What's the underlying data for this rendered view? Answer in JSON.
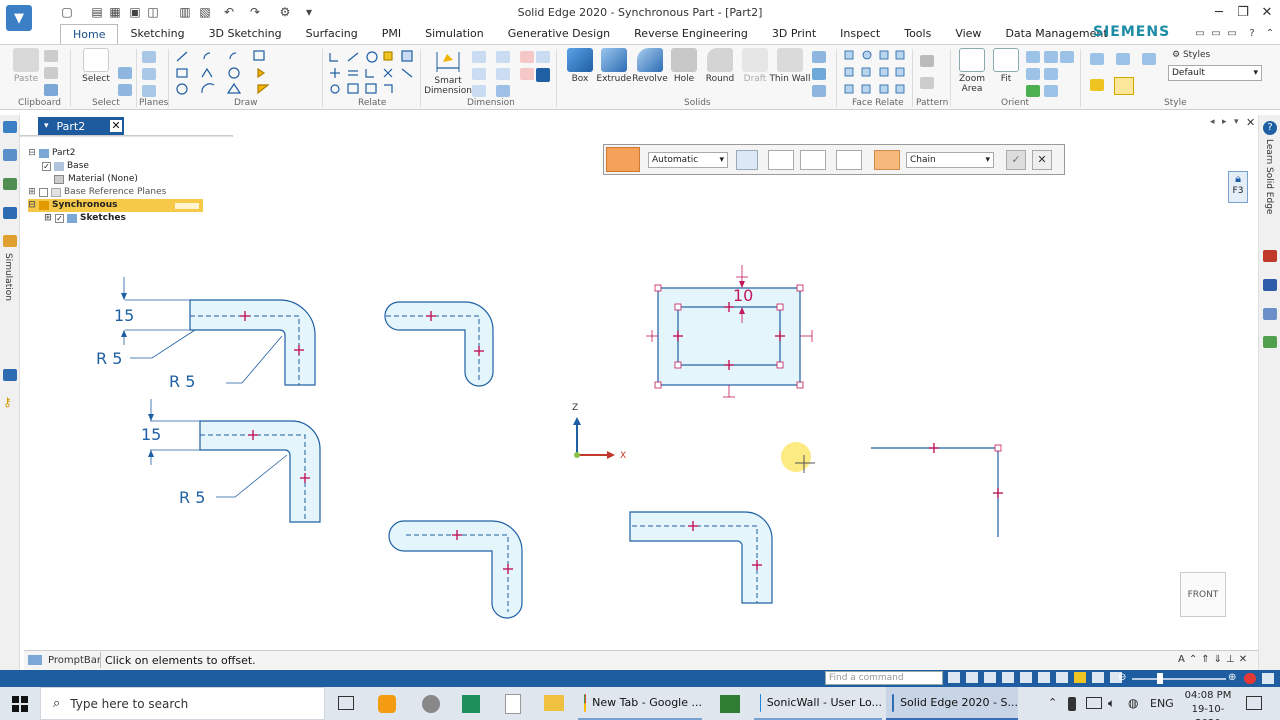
{
  "window": {
    "title": "Solid Edge 2020 - Synchronous Part - [Part2]",
    "brand": "SIEMENS"
  },
  "ribbon_tabs": [
    "Home",
    "Sketching",
    "3D Sketching",
    "Surfacing",
    "PMI",
    "Simulation",
    "Generative Design",
    "Reverse Engineering",
    "3D Print",
    "Inspect",
    "Tools",
    "View",
    "Data Management"
  ],
  "ribbon": {
    "groups": {
      "clipboard": "Clipboard",
      "select": "Select",
      "planes": "Planes",
      "draw": "Draw",
      "relate": "Relate",
      "dimension": "Dimension",
      "solids": "Solids",
      "face_relate": "Face Relate",
      "pattern": "Pattern",
      "orient": "Orient",
      "style": "Style"
    },
    "buttons": {
      "paste": "Paste",
      "select": "Select",
      "smart_dimension": "Smart Dimension",
      "box": "Box",
      "extrude": "Extrude",
      "revolve": "Revolve",
      "hole": "Hole",
      "round": "Round",
      "draft": "Draft",
      "thin_wall": "Thin Wall",
      "zoom_area": "Zoom Area",
      "fit": "Fit",
      "styles": "Styles"
    },
    "style_value": "Default"
  },
  "document_tab": "Part2",
  "tree": {
    "root": "Part2",
    "base": "Base",
    "material": "Material (None)",
    "planes": "Base Reference Planes",
    "synchronous": "Synchronous",
    "sketches": "Sketches"
  },
  "command_bar": {
    "mode": "Automatic",
    "select": "Chain"
  },
  "canvas": {
    "dims": {
      "d15a": "15",
      "d15b": "15",
      "r5a": "R 5",
      "r5b": "R 5",
      "r5c": "R 5",
      "d10": "10"
    },
    "axes": {
      "z": "Z",
      "x": "X"
    },
    "view_label": "FRONT"
  },
  "right_panel": {
    "learn": "Learn Solid Edge",
    "lock_key": "F3"
  },
  "left_panel": {
    "simulation": "Simulation"
  },
  "prompt": {
    "label": "PromptBar",
    "message": "Click on elements to offset."
  },
  "statusbar": {
    "find_placeholder": "Find a command"
  },
  "taskbar": {
    "search_placeholder": "Type here to search",
    "chrome": "New Tab - Google ...",
    "sonicwall": "SonicWall - User Lo...",
    "solidedge": "Solid Edge 2020 - S...",
    "lang": "ENG",
    "time": "04:08 PM",
    "date": "19-10-2020"
  },
  "colors": {
    "accent_blue": "#1f5fa3",
    "sketch_fill": "#e4f6fb",
    "handle_magenta": "#c0185a",
    "selected_yellow": "#fce27a"
  }
}
